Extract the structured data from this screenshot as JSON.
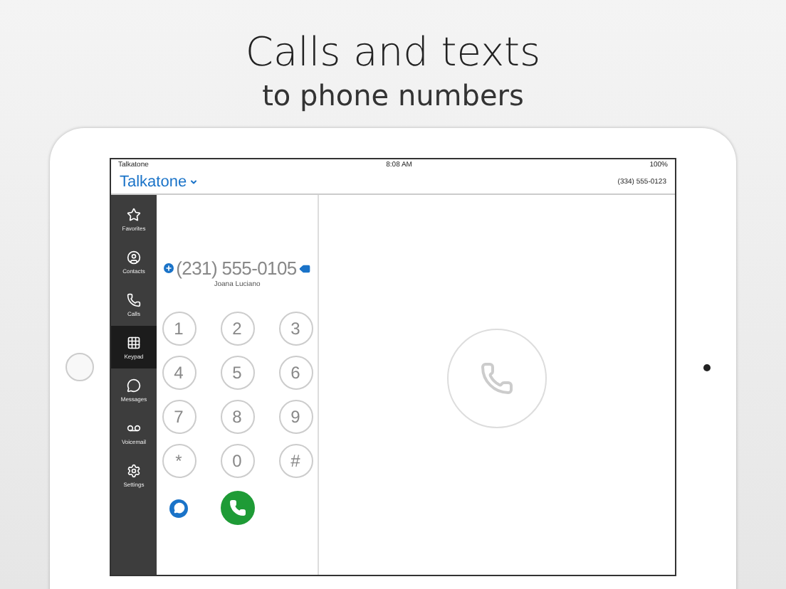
{
  "headline": "Calls and texts",
  "subheadline": "to phone numbers",
  "status_bar": {
    "carrier": "Talkatone",
    "time": "8:08 AM",
    "battery": "100%"
  },
  "nav": {
    "title": "Talkatone",
    "phone_number": "(334) 555-0123"
  },
  "sidebar": [
    {
      "label": "Favorites",
      "kind": "star",
      "selected": false
    },
    {
      "label": "Contacts",
      "kind": "person",
      "selected": false
    },
    {
      "label": "Calls",
      "kind": "phone",
      "selected": false
    },
    {
      "label": "Keypad",
      "kind": "grid",
      "selected": true
    },
    {
      "label": "Messages",
      "kind": "bubble",
      "selected": false
    },
    {
      "label": "Voicemail",
      "kind": "voicemail",
      "selected": false
    },
    {
      "label": "Settings",
      "kind": "gear",
      "selected": false
    }
  ],
  "dialer": {
    "number": "(231) 555-0105",
    "contact": "Joana Luciano",
    "keys": [
      {
        "digit": "1"
      },
      {
        "digit": "2"
      },
      {
        "digit": "3"
      },
      {
        "digit": "4"
      },
      {
        "digit": "5"
      },
      {
        "digit": "6"
      },
      {
        "digit": "7"
      },
      {
        "digit": "8"
      },
      {
        "digit": "9"
      },
      {
        "digit": "*"
      },
      {
        "digit": "0"
      },
      {
        "digit": "#"
      }
    ]
  }
}
